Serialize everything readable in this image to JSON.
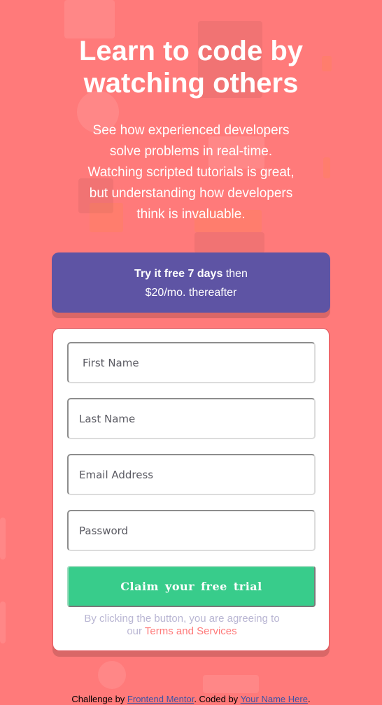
{
  "hero": {
    "heading_line1": "Learn to code by",
    "heading_line2": "watching others",
    "intro_line1": "See how experienced developers",
    "intro_line2": "solve problems in real-time.",
    "intro_line3": "Watching scripted tutorials is great,",
    "intro_line4": "but understanding how developers",
    "intro_line5": "think is invaluable."
  },
  "promo": {
    "bold_text": "Try it free 7 days",
    "after_bold": " then",
    "line2": "$20/mo. thereafter"
  },
  "form": {
    "first_name_placeholder": "First Name",
    "last_name_placeholder": "Last Name",
    "email_placeholder": "Email Address",
    "password_placeholder": "Password",
    "submit_label": "Claim your free trial",
    "terms_prefix_line1": "By clicking the button, you are agreeing to",
    "terms_prefix_line2": "our ",
    "terms_link": "Terms and Services"
  },
  "footer": {
    "prefix": "Challenge by ",
    "link1": "Frontend Mentor",
    "middle": ". Coded by ",
    "link2": "Your Name Here",
    "suffix": "."
  },
  "colors": {
    "background": "#ff7a7a",
    "promo": "#5e54a4",
    "button": "#38cc8b",
    "terms_link": "#ff7a7a"
  }
}
